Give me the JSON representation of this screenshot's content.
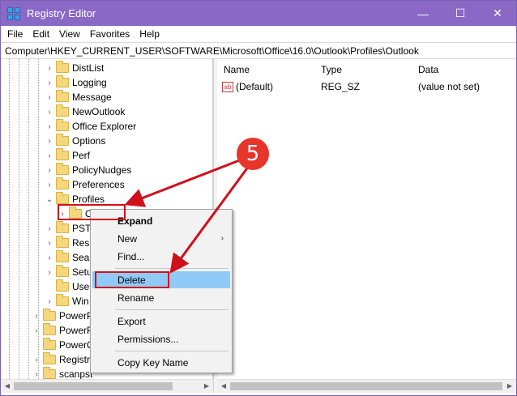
{
  "window": {
    "title": "Registry Editor",
    "accent": "#8a68c6"
  },
  "controls": {
    "minimize": "—",
    "maximize": "☐",
    "close": "✕"
  },
  "menu": [
    "File",
    "Edit",
    "View",
    "Favorites",
    "Help"
  ],
  "address": "Computer\\HKEY_CURRENT_USER\\SOFTWARE\\Microsoft\\Office\\16.0\\Outlook\\Profiles\\Outlook",
  "tree": {
    "items": [
      {
        "label": "DistList",
        "expander": "›"
      },
      {
        "label": "Logging",
        "expander": "›"
      },
      {
        "label": "Message",
        "expander": "›"
      },
      {
        "label": "NewOutlook",
        "expander": "›"
      },
      {
        "label": "Office Explorer",
        "expander": "›"
      },
      {
        "label": "Options",
        "expander": "›"
      },
      {
        "label": "Perf",
        "expander": "›"
      },
      {
        "label": "PolicyNudges",
        "expander": "›"
      },
      {
        "label": "Preferences",
        "expander": "›"
      },
      {
        "label": "Profiles",
        "expander": "⌄"
      },
      {
        "label": "O",
        "expander": "›"
      },
      {
        "label": "PST",
        "expander": "›"
      },
      {
        "label": "Resi",
        "expander": "›"
      },
      {
        "label": "Sear",
        "expander": "›"
      },
      {
        "label": "Setu",
        "expander": "›"
      },
      {
        "label": "User",
        "expander": ""
      },
      {
        "label": "Win",
        "expander": "›"
      },
      {
        "label": "PowerP",
        "expander": "›"
      },
      {
        "label": "PowerP",
        "expander": "›"
      },
      {
        "label": "PowerQ",
        "expander": ""
      },
      {
        "label": "Registra",
        "expander": "›"
      },
      {
        "label": "scanpst",
        "expander": "›"
      }
    ]
  },
  "values": {
    "headers": [
      "Name",
      "Type",
      "Data"
    ],
    "rows": [
      {
        "name": "(Default)",
        "type": "REG_SZ",
        "data": "(value not set)"
      }
    ]
  },
  "context_menu": {
    "expand": "Expand",
    "new": "New",
    "find": "Find...",
    "delete": "Delete",
    "rename": "Rename",
    "export": "Export",
    "permissions": "Permissions...",
    "copy_key_name": "Copy Key Name",
    "submenu_arrow": "›"
  },
  "annotation": {
    "badge": "5",
    "color": "#d0101a"
  }
}
